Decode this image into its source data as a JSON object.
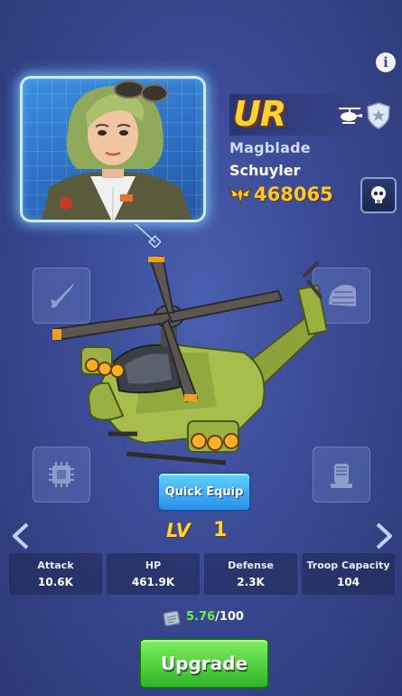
{
  "hero": {
    "rarity": "UR",
    "vehicle_name": "Magblade",
    "hero_name": "Schuyler",
    "power": "468065"
  },
  "level": {
    "label": "LV",
    "value": "1"
  },
  "buttons": {
    "quick_equip": "Quick Equip",
    "upgrade": "Upgrade"
  },
  "stats": [
    {
      "label": "Attack",
      "value": "10.6K"
    },
    {
      "label": "HP",
      "value": "461.9K"
    },
    {
      "label": "Defense",
      "value": "2.3K"
    },
    {
      "label": "Troop Capacity",
      "value": "104"
    }
  ],
  "materials": {
    "current": "5.76",
    "total": "/100"
  },
  "icons": {
    "info": "info-icon",
    "type": "helicopter-icon",
    "shield": "shield-icon",
    "power": "power-wings-icon",
    "skull": "skull-icon",
    "material": "blueprint-icon"
  },
  "colors": {
    "rarity": "#ffd23a",
    "power": "#ffc630",
    "material_current": "#6cf04a",
    "quick_equip": "#2a8ee8",
    "upgrade": "#2fb32a"
  }
}
